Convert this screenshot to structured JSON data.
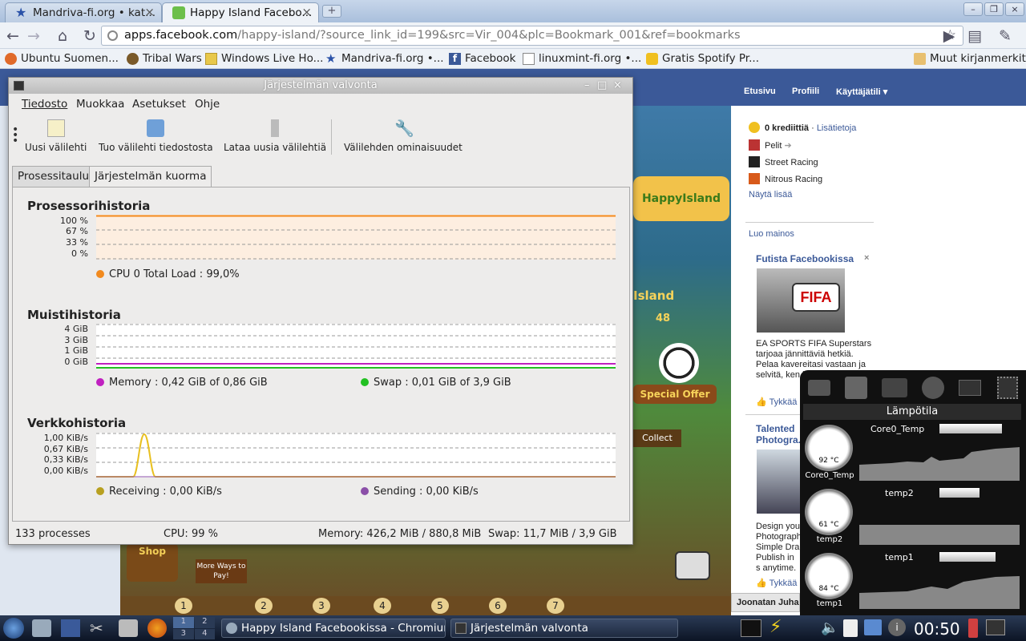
{
  "browser": {
    "tabs": [
      {
        "label": "Mandriva-fi.org • kat..."
      },
      {
        "label": "Happy Island Facebo..."
      }
    ],
    "url_host": "apps.facebook.com",
    "url_path": "/happy-island/?source_link_id=199&src=Vir_004&plc=Bookmark_001&ref=bookmarks",
    "bookmarks": [
      {
        "label": "Ubuntu Suomen..."
      },
      {
        "label": "Tribal Wars"
      },
      {
        "label": "Windows Live Ho..."
      },
      {
        "label": "Mandriva-fi.org •..."
      },
      {
        "label": "Facebook"
      },
      {
        "label": "linuxmint-fi.org •..."
      },
      {
        "label": "Gratis Spotify Pr..."
      }
    ],
    "other_bookmarks": "Muut kirjanmerkit"
  },
  "facebook": {
    "nav": [
      "Etusivu",
      "Profiili",
      "Käyttäjätili"
    ],
    "credits": "0 krediittiä",
    "credits_link": "Lisätietoja",
    "apps": [
      "Pelit",
      "Street Racing",
      "Nitrous Racing"
    ],
    "show_more": "Näytä lisää",
    "create_ad": "Luo mainos",
    "ad1_title": "Futista Facebookissa",
    "ad1_text": "EA SPORTS FIFA Superstars tarjoaa jännittäviä hetkiä. Pelaa kavereitasi vastaan ja selvitä, ken joukkue. P...",
    "like": "Tykkää",
    "ad2_title": "Talented Photogra...",
    "ad2_text": "Design you Photograph Simple Dra Publish in s anytime. S",
    "chat_name": "Joonatan Juha..."
  },
  "sysmon": {
    "title": "Järjestelmän valvonta",
    "menu": [
      "Tiedosto",
      "Muokkaa",
      "Asetukset",
      "Ohje"
    ],
    "toolbar": [
      "Uusi välilehti",
      "Tuo välilehti tiedostosta",
      "Lataa uusia välilehtiä",
      "Välilehden ominaisuudet"
    ],
    "tabs": [
      "Prosessitaulu",
      "Järjestelmän kuorma"
    ],
    "cpu": {
      "title": "Prosessorihistoria",
      "ticks": [
        "100 %",
        "67 %",
        "33 %",
        "0 %"
      ],
      "legend_label": "CPU 0 Total Load :",
      "legend_value": "99,0%",
      "color": "#f28a1e",
      "level": 0.99
    },
    "mem": {
      "title": "Muistihistoria",
      "ticks": [
        "4 GiB",
        "3 GiB",
        "1 GiB",
        "0 GiB"
      ],
      "memory_label": "Memory :",
      "memory_value": "0,42 GiB of 0,86 GiB",
      "memory_color": "#c020c0",
      "swap_label": "Swap :",
      "swap_value": "0,01 GiB of 3,9 GiB",
      "swap_color": "#22c022"
    },
    "net": {
      "title": "Verkkohistoria",
      "ticks": [
        "1,00 KiB/s",
        "0,67 KiB/s",
        "0,33 KiB/s",
        "0,00 KiB/s"
      ],
      "recv_label": "Receiving :",
      "recv_value": "0,00 KiB/s",
      "recv_color": "#b8a020",
      "send_label": "Sending :",
      "send_value": "0,00 KiB/s",
      "send_color": "#8b4fa8"
    },
    "status": {
      "processes": "133 processes",
      "cpu": "CPU: 99 %",
      "memory": "Memory: 426,2 MiB / 880,8 MiB",
      "swap": "Swap: 11,7 MiB / 3,9 GiB"
    }
  },
  "temperature": {
    "title": "Lämpötila",
    "sensors": [
      {
        "name": "Core0_Temp",
        "value": "92 °C"
      },
      {
        "name": "temp2",
        "value": "61 °C"
      },
      {
        "name": "temp1",
        "value": "84 °C"
      }
    ]
  },
  "taskbar": {
    "tasks": [
      "Happy Island Facebookissa - Chromium",
      "Järjestelmän valvonta"
    ],
    "clock": "00:50",
    "workspaces": [
      "1",
      "2",
      "3",
      "4"
    ]
  },
  "game": {
    "hud_numbers": [
      "1",
      "2",
      "3",
      "4",
      "5",
      "6",
      "7"
    ],
    "labels": [
      "Shop",
      "More Ways to Pay!",
      "Collect",
      "Special Offer",
      "Island",
      "48"
    ]
  }
}
